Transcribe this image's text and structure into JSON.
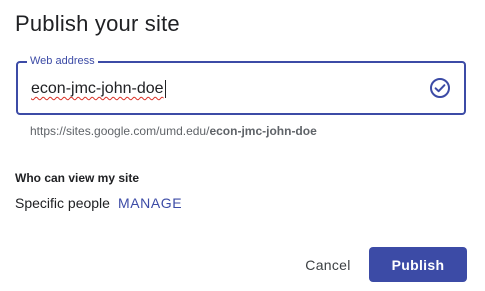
{
  "dialog": {
    "title": "Publish your site"
  },
  "web_address": {
    "label": "Web address",
    "value": "econ-jmc-john-doe",
    "valid": true
  },
  "url_preview": {
    "prefix": "https://sites.google.com/umd.edu/",
    "slug": "econ-jmc-john-doe"
  },
  "visibility": {
    "heading": "Who can view my site",
    "value": "Specific people",
    "manage_label": "MANAGE"
  },
  "actions": {
    "cancel_label": "Cancel",
    "publish_label": "Publish"
  },
  "colors": {
    "accent": "#3c4ba6",
    "text_primary": "#202124",
    "text_secondary": "#5f6368",
    "spellcheck": "#d93025"
  },
  "icons": {
    "validation": "check-circle-icon"
  }
}
